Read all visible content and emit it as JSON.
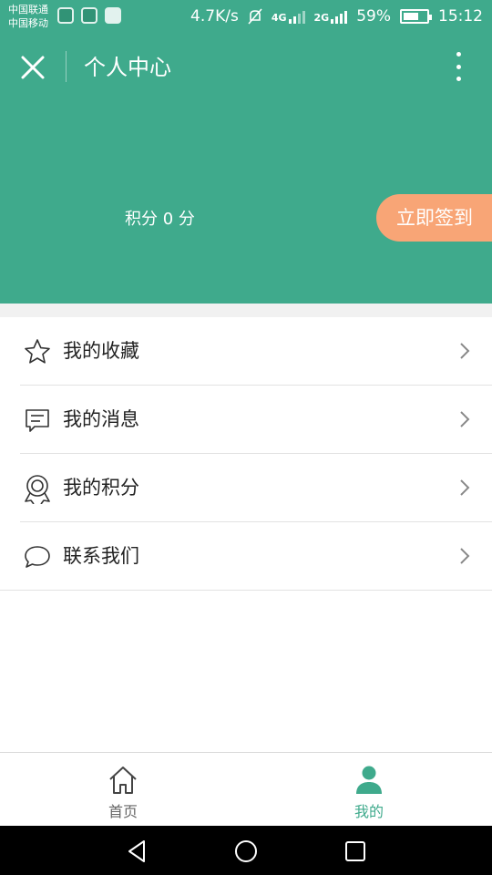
{
  "status_bar": {
    "carrier_1": "中国联通",
    "carrier_2": "中国移动",
    "speed": "4.7K/s",
    "network_4g": "4G",
    "network_2g": "2G",
    "battery": "59%",
    "time": "15:12"
  },
  "header": {
    "title": "个人中心",
    "points_text": "积分 0 分",
    "checkin_label": "立即签到"
  },
  "menu": [
    {
      "label": "我的收藏",
      "icon": "star-icon"
    },
    {
      "label": "我的消息",
      "icon": "message-icon"
    },
    {
      "label": "我的积分",
      "icon": "badge-icon"
    },
    {
      "label": "联系我们",
      "icon": "chat-bubble-icon"
    }
  ],
  "tabbar": {
    "home_label": "首页",
    "me_label": "我的"
  },
  "colors": {
    "brand": "#3faa8c",
    "checkin": "#f8a576"
  }
}
